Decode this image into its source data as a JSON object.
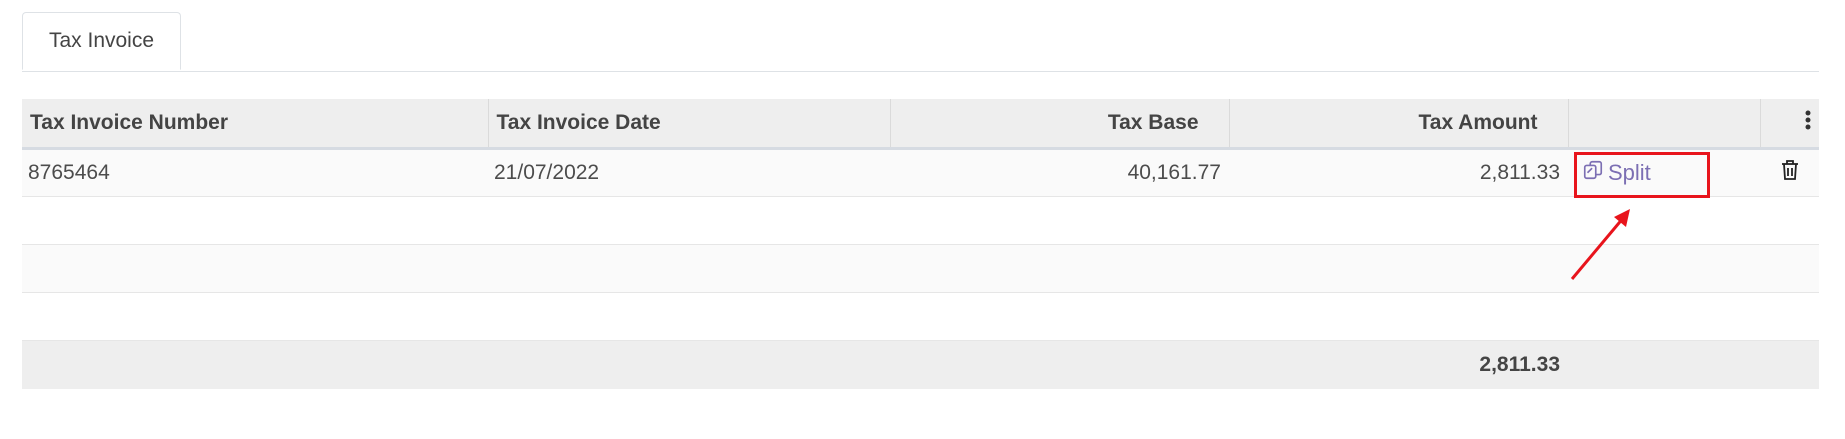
{
  "tabs": [
    {
      "label": "Tax Invoice"
    }
  ],
  "table": {
    "columns": [
      "Tax Invoice Number",
      "Tax Invoice Date",
      "Tax Base",
      "Tax Amount",
      "",
      ""
    ],
    "rows": [
      {
        "number": "8765464",
        "date": "21/07/2022",
        "base": "40,161.77",
        "amount": "2,811.33",
        "action_label": "Split"
      }
    ],
    "total_amount": "2,811.33"
  },
  "annotation": {
    "color": "#e8141c"
  },
  "accent_color": "#7c6fb3"
}
